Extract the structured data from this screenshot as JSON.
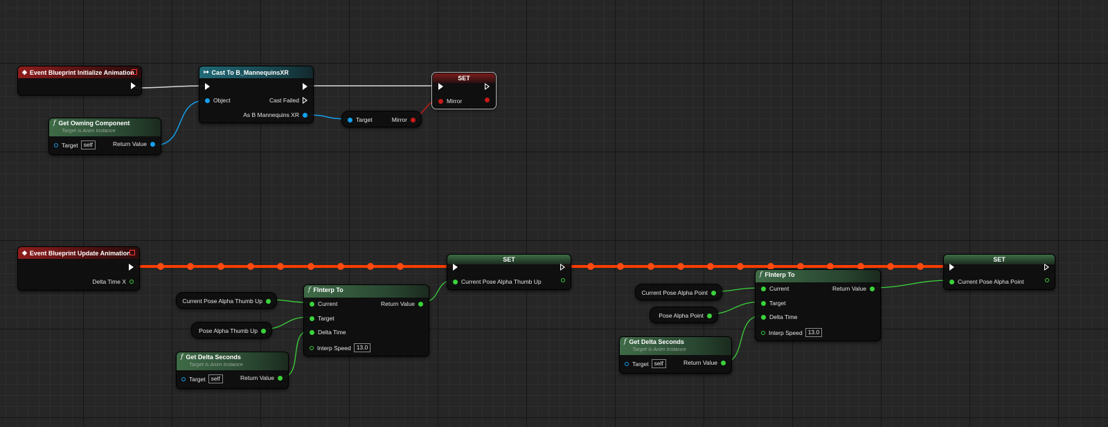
{
  "nodes": {
    "event_init": {
      "title": "Event Blueprint Initialize Animation"
    },
    "cast": {
      "title": "Cast To B_MannequinsXR",
      "object_label": "Object",
      "cast_failed_label": "Cast Failed",
      "as_label": "As B Mannequins XR"
    },
    "get_owning": {
      "title": "Get Owning Component",
      "subtitle": "Target is Anim Instance",
      "target_label": "Target",
      "target_value": "self",
      "return_label": "Return Value"
    },
    "set_mirror": {
      "title": "SET",
      "var_label": "Mirror"
    },
    "mirror_getter": {
      "target_label": "Target",
      "var_label": "Mirror"
    },
    "event_update": {
      "title": "Event Blueprint Update Animation",
      "delta_label": "Delta Time X"
    },
    "set_thumb": {
      "title": "SET",
      "var_label": "Current Pose Alpha Thumb Up"
    },
    "get_current_thumb": {
      "label": "Current Pose Alpha Thumb Up"
    },
    "get_pose_thumb": {
      "label": "Pose Alpha Thumb Up"
    },
    "finterp_1": {
      "title": "FInterp To",
      "current_label": "Current",
      "target_label": "Target",
      "delta_label": "Delta Time",
      "speed_label": "Interp Speed",
      "speed_value": "13.0",
      "return_label": "Return Value"
    },
    "get_delta_1": {
      "title": "Get Delta Seconds",
      "subtitle": "Target is Anim Instance",
      "target_label": "Target",
      "target_value": "self",
      "return_label": "Return Value"
    },
    "get_current_point": {
      "label": "Current Pose Alpha Point"
    },
    "get_pose_point": {
      "label": "Pose Alpha Point"
    },
    "finterp_2": {
      "title": "FInterp To",
      "current_label": "Current",
      "target_label": "Target",
      "delta_label": "Delta Time",
      "speed_label": "Interp Speed",
      "speed_value": "13.0",
      "return_label": "Return Value"
    },
    "get_delta_2": {
      "title": "Get Delta Seconds",
      "subtitle": "Target is Anim Instance",
      "target_label": "Target",
      "target_value": "self",
      "return_label": "Return Value"
    },
    "set_point": {
      "title": "SET",
      "var_label": "Current Pose Alpha Point"
    }
  },
  "colors": {
    "exec": "#ffffff",
    "object": "#14a0ee",
    "float": "#3bd33b",
    "bool": "#c81a1a",
    "active_exec": "#ff3d00"
  }
}
